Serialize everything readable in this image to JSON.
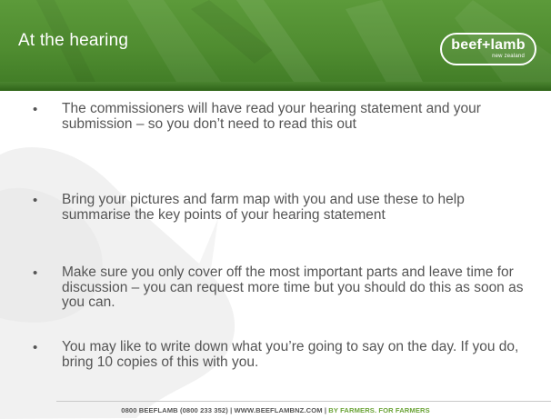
{
  "slide": {
    "title": "At the hearing",
    "logo": {
      "main": "beef+lamb",
      "sub": "new zealand"
    },
    "bullets": [
      {
        "text": "The commissioners will have read your hearing statement and your submission – so you don’t need to read this out"
      },
      {
        "text": "Bring your pictures and farm map with you and use these to help summarise the key points of your hearing statement"
      },
      {
        "text": "Make sure you only cover off the most important parts and leave time for discussion – you can request more time but you should do this as soon as you can."
      },
      {
        "text": "You may like to write down what you’re going to say on the day. If you do, bring 10 copies of this with you."
      }
    ],
    "bullet_glyph": "•",
    "footer": {
      "contact": "0800 BEEFLAMB (0800 233 352) | WWW.BEEFLAMBNZ.COM |",
      "tagline": "BY FARMERS. FOR FARMERS"
    }
  },
  "colors": {
    "header_green": "#4f8c30",
    "text_grey": "#555555",
    "accent_green": "#6aa336"
  }
}
